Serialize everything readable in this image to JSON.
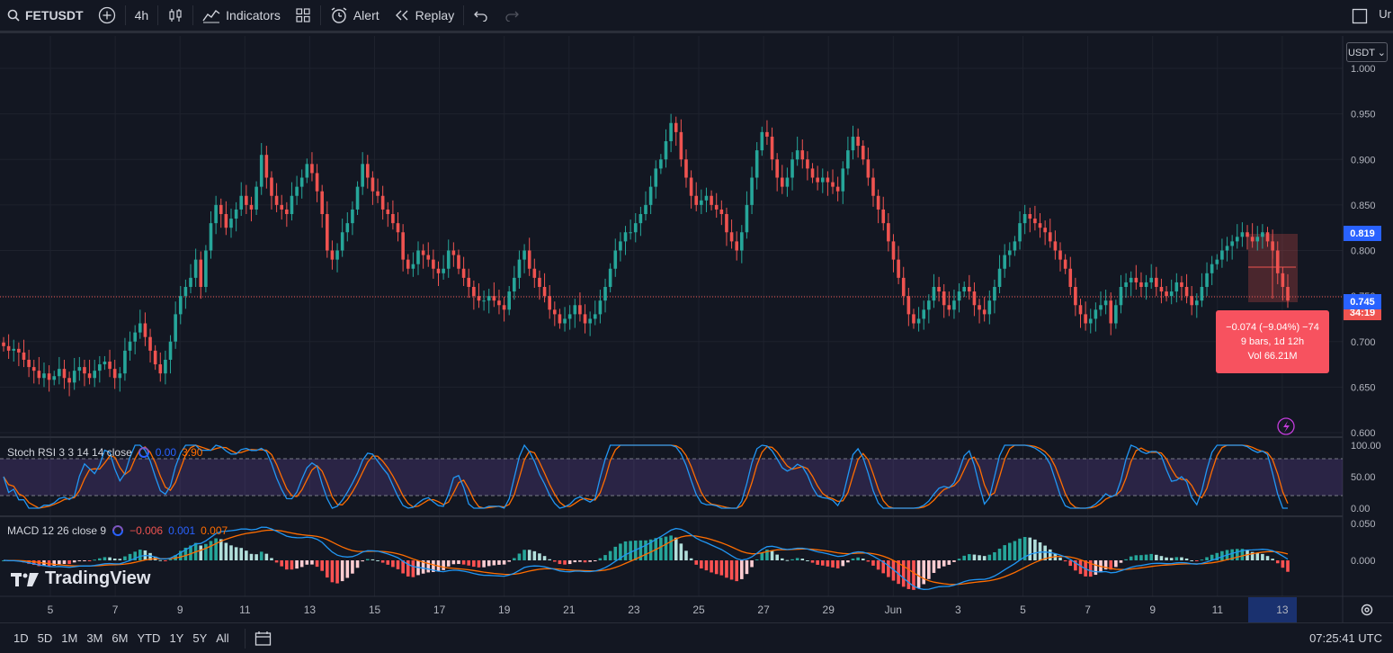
{
  "toolbar": {
    "symbol": "FETUSDT",
    "interval": "4h",
    "indicators_label": "Indicators",
    "alert_label": "Alert",
    "replay_label": "Replay",
    "right_cut_text": "Ur"
  },
  "price_axis": {
    "currency": "USDT ⌄",
    "ticks": [
      "1.000",
      "0.950",
      "0.900",
      "0.850",
      "0.800",
      "0.750",
      "0.700",
      "0.650",
      "0.600"
    ],
    "tag_blue": "0.819",
    "tag_last": "0.745",
    "tag_hidden": "34:19"
  },
  "measure": {
    "line1": "−0.074 (−9.04%) −74",
    "line2": "9 bars, 1d 12h",
    "line3": "Vol 66.21M"
  },
  "stoch": {
    "title": "Stoch RSI 3 3 14 14 close",
    "k": "0.00",
    "d": "3.90",
    "ticks": [
      "100.00",
      "50.00",
      "0.00"
    ]
  },
  "macd": {
    "title": "MACD 12 26 close 9",
    "hist": "−0.006",
    "macd": "0.001",
    "signal": "0.007",
    "ticks": [
      "0.050",
      "0.000"
    ]
  },
  "time_axis": {
    "labels": [
      "5",
      "7",
      "9",
      "11",
      "13",
      "15",
      "17",
      "19",
      "21",
      "23",
      "25",
      "27",
      "29",
      "Jun",
      "3",
      "5",
      "7",
      "9",
      "11",
      "13"
    ]
  },
  "watermark": "TradingView",
  "ranges": [
    "1D",
    "5D",
    "1M",
    "3M",
    "6M",
    "YTD",
    "1Y",
    "5Y",
    "All"
  ],
  "clock": "07:25:41 UTC",
  "colors": {
    "up": "#26a69a",
    "down": "#ef5350",
    "bg": "#131722",
    "accent": "#2962ff"
  },
  "chart_data": {
    "type": "candlestick",
    "symbol": "FETUSDT",
    "interval": "4h",
    "ylim": [
      0.6,
      1.0
    ],
    "closes": [
      0.695,
      0.69,
      0.692,
      0.688,
      0.68,
      0.672,
      0.668,
      0.66,
      0.665,
      0.658,
      0.662,
      0.67,
      0.66,
      0.655,
      0.668,
      0.672,
      0.665,
      0.66,
      0.668,
      0.675,
      0.678,
      0.67,
      0.66,
      0.665,
      0.69,
      0.7,
      0.71,
      0.72,
      0.705,
      0.69,
      0.675,
      0.665,
      0.68,
      0.7,
      0.73,
      0.75,
      0.76,
      0.77,
      0.79,
      0.76,
      0.8,
      0.83,
      0.85,
      0.84,
      0.825,
      0.835,
      0.845,
      0.86,
      0.85,
      0.845,
      0.87,
      0.905,
      0.88,
      0.86,
      0.85,
      0.845,
      0.84,
      0.86,
      0.87,
      0.88,
      0.895,
      0.885,
      0.865,
      0.84,
      0.8,
      0.79,
      0.8,
      0.82,
      0.83,
      0.845,
      0.87,
      0.895,
      0.88,
      0.865,
      0.86,
      0.845,
      0.84,
      0.83,
      0.82,
      0.79,
      0.78,
      0.785,
      0.8,
      0.795,
      0.79,
      0.78,
      0.775,
      0.78,
      0.8,
      0.795,
      0.78,
      0.77,
      0.76,
      0.75,
      0.745,
      0.745,
      0.75,
      0.745,
      0.74,
      0.735,
      0.755,
      0.77,
      0.79,
      0.8,
      0.78,
      0.77,
      0.76,
      0.75,
      0.735,
      0.73,
      0.72,
      0.725,
      0.73,
      0.74,
      0.73,
      0.72,
      0.725,
      0.73,
      0.745,
      0.76,
      0.78,
      0.8,
      0.81,
      0.82,
      0.82,
      0.83,
      0.84,
      0.85,
      0.87,
      0.89,
      0.9,
      0.92,
      0.94,
      0.93,
      0.9,
      0.88,
      0.86,
      0.85,
      0.855,
      0.86,
      0.85,
      0.845,
      0.84,
      0.82,
      0.81,
      0.8,
      0.82,
      0.85,
      0.88,
      0.91,
      0.93,
      0.925,
      0.9,
      0.88,
      0.87,
      0.88,
      0.9,
      0.91,
      0.9,
      0.89,
      0.88,
      0.875,
      0.88,
      0.875,
      0.87,
      0.865,
      0.89,
      0.91,
      0.925,
      0.915,
      0.9,
      0.88,
      0.86,
      0.845,
      0.83,
      0.81,
      0.79,
      0.77,
      0.75,
      0.73,
      0.72,
      0.725,
      0.735,
      0.745,
      0.76,
      0.755,
      0.74,
      0.735,
      0.745,
      0.755,
      0.76,
      0.755,
      0.74,
      0.735,
      0.73,
      0.745,
      0.76,
      0.78,
      0.795,
      0.8,
      0.81,
      0.83,
      0.84,
      0.835,
      0.83,
      0.825,
      0.82,
      0.81,
      0.8,
      0.79,
      0.78,
      0.76,
      0.74,
      0.73,
      0.72,
      0.725,
      0.735,
      0.74,
      0.745,
      0.72,
      0.74,
      0.76,
      0.765,
      0.77,
      0.765,
      0.76,
      0.765,
      0.77,
      0.76,
      0.755,
      0.75,
      0.755,
      0.765,
      0.76,
      0.75,
      0.74,
      0.745,
      0.76,
      0.775,
      0.785,
      0.79,
      0.8,
      0.805,
      0.81,
      0.815,
      0.82,
      0.815,
      0.81,
      0.815,
      0.82,
      0.81,
      0.8,
      0.775,
      0.76,
      0.745
    ]
  }
}
